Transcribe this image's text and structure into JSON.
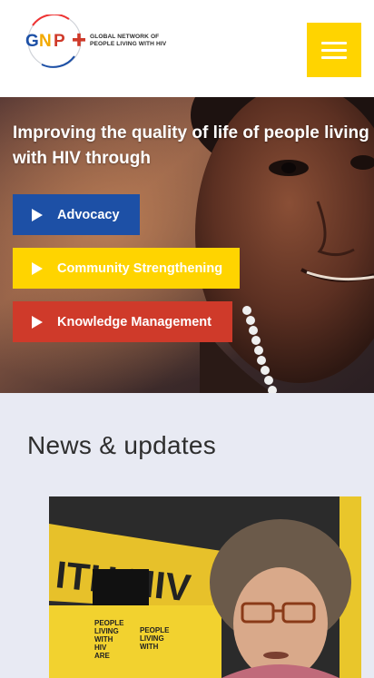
{
  "header": {
    "logo": {
      "mark": "GNP+",
      "line1": "GLOBAL NETWORK OF",
      "line2": "PEOPLE LIVING WITH HIV"
    },
    "menu_icon": "hamburger-menu-icon",
    "menu_color": "#ffd400"
  },
  "hero": {
    "title": "Improving the quality of life of people living with HIV through",
    "buttons": [
      {
        "label": "Advocacy",
        "color": "#1d50a6",
        "icon": "play-icon"
      },
      {
        "label": "Community Strengthening",
        "color": "#ffd400",
        "icon": "play-icon"
      },
      {
        "label": "Knowledge Management",
        "color": "#cf3a2a",
        "icon": "play-icon"
      }
    ]
  },
  "news": {
    "title": "News & updates",
    "featured_image_text": {
      "banner": "ITH HIV",
      "placards": [
        "PEOPLE",
        "LIVING",
        "WITH",
        "HIV",
        "ARE"
      ]
    }
  },
  "colors": {
    "accent_yellow": "#ffd400",
    "blue": "#1d50a6",
    "red": "#cf3a2a",
    "page_bg": "#e8eaf3"
  }
}
